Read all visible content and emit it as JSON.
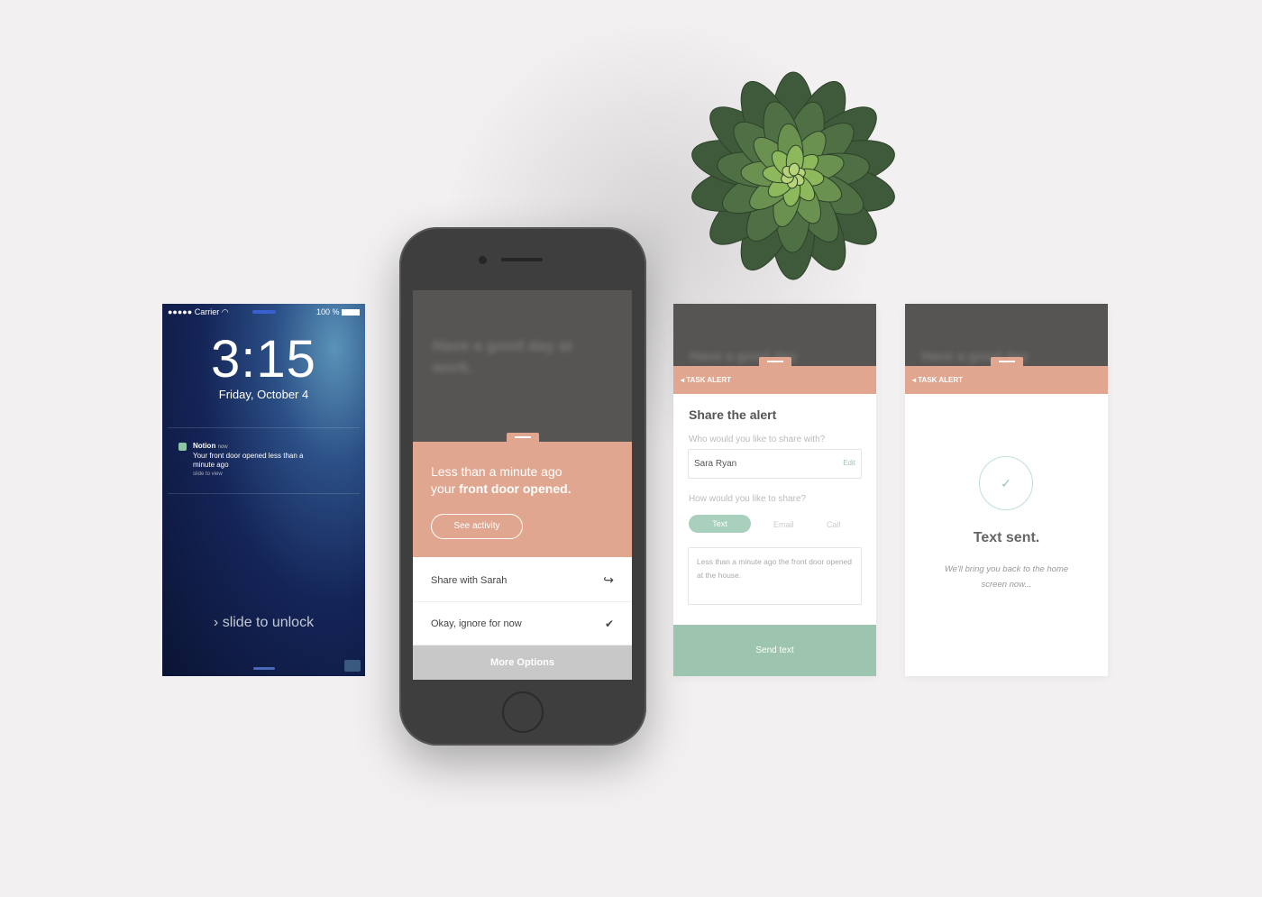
{
  "lock_screen": {
    "signal": "●●●●●",
    "carrier": "Carrier",
    "battery": "100 %",
    "time": "3:15",
    "date": "Friday, October 4",
    "notification": {
      "app": "Notion",
      "when": "now",
      "message": "Your front door opened less than a minute ago",
      "hint": "slide to view"
    },
    "unlock": "slide to unlock"
  },
  "alert_screen": {
    "background_text": "Have a good day at work.",
    "alert_line1": "Less than a minute ago",
    "alert_line2_prefix": "your ",
    "alert_line2_bold": "front door opened.",
    "see_activity": "See activity",
    "actions": [
      {
        "label": "Share with Sarah",
        "icon": "share-arrow-icon"
      },
      {
        "label": "Okay, ignore for now",
        "icon": "check-icon"
      }
    ],
    "more_options": "More Options"
  },
  "share_screen": {
    "background_text": "Have a good day",
    "header": "TASK ALERT",
    "title": "Share the alert",
    "who_label": "Who would you like to share with?",
    "who_value": "Sara Ryan",
    "edit": "Edit",
    "how_label": "How would you like to share?",
    "methods": [
      "Text",
      "Email",
      "Call"
    ],
    "selected_method": "Text",
    "message": "Less than a minute ago the front door opened at the house.",
    "send": "Send text"
  },
  "sent_screen": {
    "background_text": "Have a good day",
    "header": "TASK ALERT",
    "title": "Text sent.",
    "message": "We'll bring you back to the home screen now..."
  },
  "colors": {
    "salmon": "#e1a68f",
    "mint": "#9cc4ae",
    "dark": "#575553"
  }
}
